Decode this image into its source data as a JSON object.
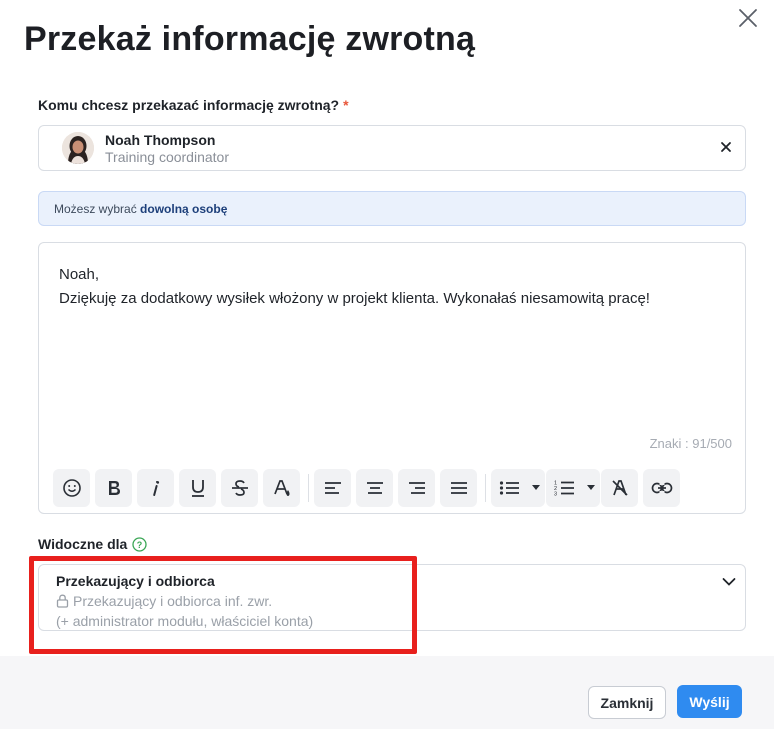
{
  "dialog": {
    "title": "Przekaż informację zwrotną"
  },
  "recipient": {
    "label": "Komu chcesz przekazać informację zwrotną?",
    "required_mark": "*",
    "name": "Noah Thompson",
    "role": "Training coordinator"
  },
  "info": {
    "text_prefix": "Możesz wybrać ",
    "text_bold": "dowolną osobę"
  },
  "editor": {
    "greeting": "Noah,",
    "body": "Dziękuję za dodatkowy wysiłek włożony w projekt klienta. Wykonałaś niesamowitą pracę!",
    "counter": "Znaki : 91/500",
    "toolbar": [
      "emoji-icon",
      "bold-icon",
      "italic-icon",
      "underline-icon",
      "strikethrough-icon",
      "text-color-icon",
      "align-left-icon",
      "align-center-icon",
      "align-right-icon",
      "justify-icon",
      "bullet-list-icon",
      "numbered-list-icon",
      "clear-format-icon",
      "link-icon"
    ]
  },
  "visibility": {
    "label": "Widoczne dla",
    "selected": "Przekazujący i odbiorca",
    "sub1": "Przekazujący i odbiorca inf. zwr.",
    "sub2": "(+ administrator modułu, właściciel konta)"
  },
  "footer": {
    "close_label": "Zamknij",
    "send_label": "Wyślij"
  },
  "colors": {
    "accent": "#2f8bf0",
    "highlight": "#e8201d",
    "required": "#e8573b"
  }
}
